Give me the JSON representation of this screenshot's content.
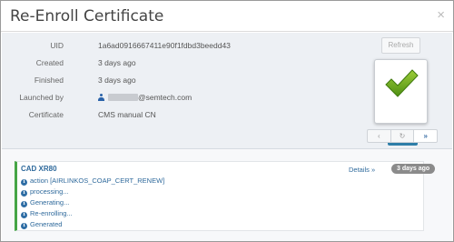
{
  "modal": {
    "title": "Re-Enroll Certificate",
    "close_label": "×"
  },
  "details": {
    "rows": [
      {
        "label": "UID",
        "value": "1a6ad0916667411e90f1fdbd3beedd43"
      },
      {
        "label": "Created",
        "value": "3 days ago"
      },
      {
        "label": "Finished",
        "value": "3 days ago"
      },
      {
        "label": "Launched by",
        "value": "@semtech.com"
      },
      {
        "label": "Certificate",
        "value": "CMS manual CN"
      }
    ]
  },
  "actions": {
    "refresh_label": "Refresh",
    "status_label": "Finished",
    "nav": [
      "‹",
      "↻",
      "»"
    ]
  },
  "log": {
    "device": "CAD XR80",
    "details_label": "Details »",
    "time": "3 days ago",
    "lines": [
      "action [AIRLINKOS_COAP_CERT_RENEW]",
      "processing...",
      "Generating...",
      "Re-enrolling...",
      "Generated"
    ]
  },
  "colors": {
    "success": "#46a546",
    "status_badge": "#2e7ea8",
    "link": "#2f6a9c"
  }
}
